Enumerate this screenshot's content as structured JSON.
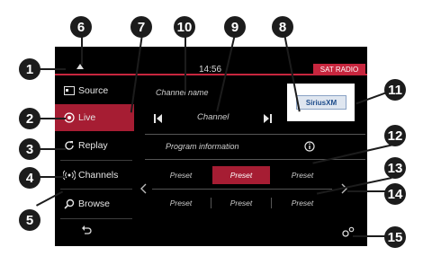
{
  "status": {
    "time": "14:56",
    "mode": "SAT RADIO"
  },
  "sidebar": {
    "items": [
      {
        "label": "Source",
        "icon": "source-icon"
      },
      {
        "label": "Live",
        "icon": "live-icon"
      },
      {
        "label": "Replay",
        "icon": "replay-icon"
      },
      {
        "label": "Channels",
        "icon": "channels-icon"
      },
      {
        "label": "Browse",
        "icon": "search-icon"
      }
    ],
    "active": "Live"
  },
  "main": {
    "channel_name": "Channel name",
    "channel": "Channel",
    "program_info": "Program information",
    "station_logo_text": "SiriusXM"
  },
  "presets": {
    "row1": [
      "Preset",
      "Preset",
      "Preset"
    ],
    "row2": [
      "Preset",
      "Preset",
      "Preset"
    ],
    "selected": "row1-2"
  },
  "callouts": [
    "1",
    "2",
    "3",
    "4",
    "5",
    "6",
    "7",
    "8",
    "9",
    "10",
    "11",
    "12",
    "13",
    "14",
    "15"
  ],
  "colors": {
    "accent": "#c7263e",
    "background": "#000000",
    "callout": "#1c1c1c"
  }
}
